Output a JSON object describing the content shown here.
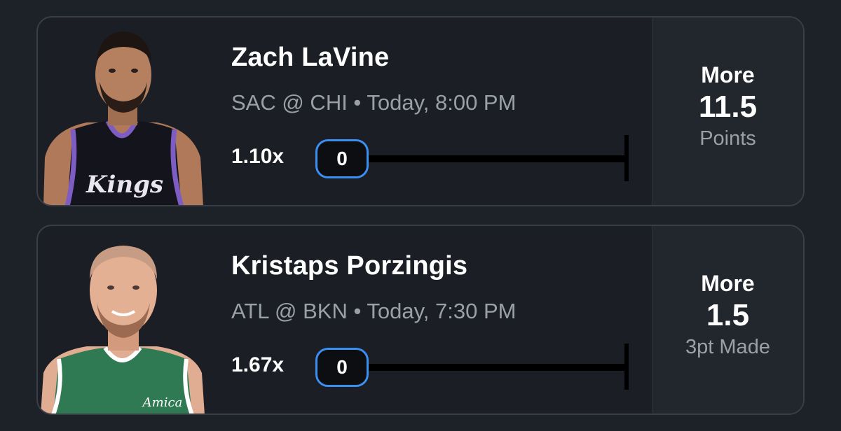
{
  "picks": [
    {
      "player": "Zach LaVine",
      "game": "SAC @ CHI • Today, 8:00 PM",
      "multiplier": "1.10x",
      "progress": "0",
      "progress_fraction": 0,
      "direction": "More",
      "line": "11.5",
      "stat": "Points",
      "jersey_text": "Kings",
      "jersey_color": "#14141c",
      "trim_color": "#7d5cc4"
    },
    {
      "player": "Kristaps Porzingis",
      "game": "ATL @ BKN • Today, 7:30 PM",
      "multiplier": "1.67x",
      "progress": "0",
      "progress_fraction": 0,
      "direction": "More",
      "line": "1.5",
      "stat": "3pt Made",
      "jersey_text": "Amica",
      "jersey_color": "#2f7a52",
      "trim_color": "#ffffff"
    }
  ],
  "colors": {
    "background": "#1d2128",
    "card": "#1b1f25",
    "accent": "#3b8ff0",
    "muted_text": "#9aa0a8"
  }
}
